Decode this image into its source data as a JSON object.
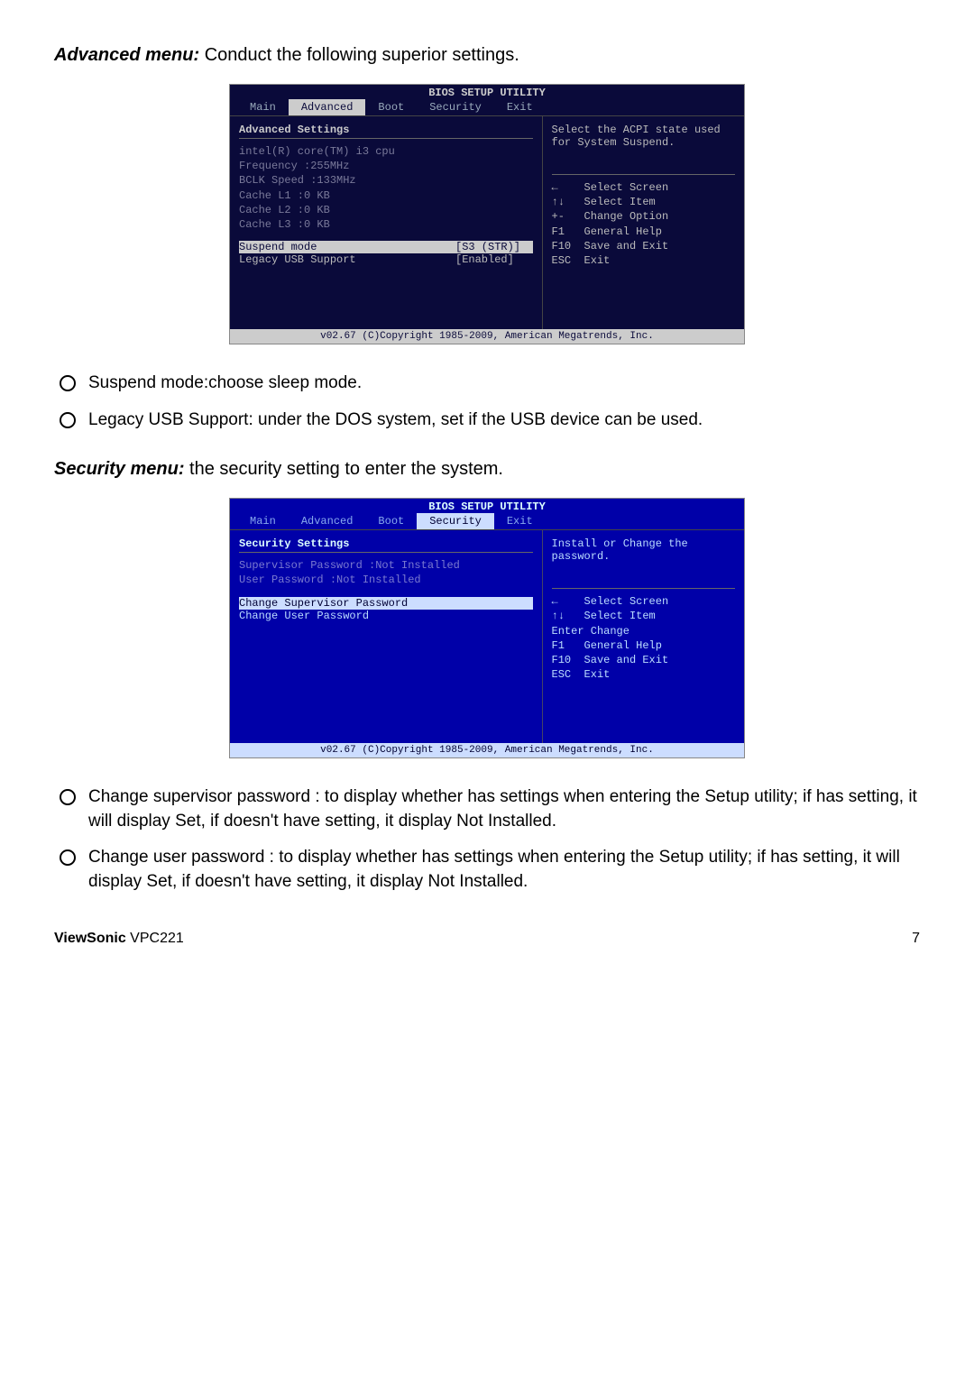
{
  "heading1": {
    "bold": "Advanced menu:",
    "rest": " Conduct the following superior settings."
  },
  "bios1": {
    "title": "BIOS SETUP UTILITY",
    "tabs": [
      "Main",
      "Advanced",
      "Boot",
      "Security",
      "Exit"
    ],
    "selected_tab": 1,
    "section": "Advanced Settings",
    "info_lines": [
      "intel(R) core(TM) i3 cpu",
      "Frequency   :255MHz",
      "BCLK Speed  :133MHz",
      "Cache L1    :0 KB",
      "Cache L2    :0 KB",
      "Cache L3    :0 KB"
    ],
    "rows": [
      {
        "label": "Suspend mode",
        "value": "[S3 (STR)]",
        "sel": true
      },
      {
        "label": "Legacy USB Support",
        "value": "[Enabled]",
        "sel": false
      }
    ],
    "help": "Select the ACPI state used for System Suspend.",
    "keys": "←    Select Screen\n↑↓   Select Item\n+-   Change Option\nF1   General Help\nF10  Save and Exit\nESC  Exit",
    "footer": "v02.67 (C)Copyright 1985-2009, American Megatrends, Inc."
  },
  "bullets1": [
    "Suspend mode:choose sleep mode.",
    "Legacy USB Support: under the DOS system, set if the USB device can be used."
  ],
  "heading2": {
    "bold": "Security menu:",
    "rest": " the security setting to enter the system."
  },
  "bios2": {
    "title": "BIOS SETUP UTILITY",
    "tabs": [
      "Main",
      "Advanced",
      "Boot",
      "Security",
      "Exit"
    ],
    "selected_tab": 3,
    "section": "Security Settings",
    "info_lines": [
      "Supervisor Password :Not Installed",
      "User Password       :Not Installed"
    ],
    "rows": [
      {
        "label": "Change Supervisor Password",
        "value": "",
        "sel": true
      },
      {
        "label": "Change User Password",
        "value": "",
        "sel": false
      }
    ],
    "help": "Install or Change the password.",
    "keys": "←    Select Screen\n↑↓   Select Item\nEnter Change\nF1   General Help\nF10  Save and Exit\nESC  Exit",
    "footer": "v02.67 (C)Copyright 1985-2009, American Megatrends, Inc."
  },
  "bullets2": [
    "Change supervisor password : to display whether has settings when entering the Setup utility; if has setting, it will display Set, if doesn't have setting, it display Not Installed.",
    "Change user password : to display whether has settings when entering the Setup utility; if has setting, it will display Set, if doesn't have setting, it display Not Installed."
  ],
  "footer": {
    "brand_bold": "ViewSonic",
    "brand_rest": " VPC221",
    "page": "7"
  }
}
